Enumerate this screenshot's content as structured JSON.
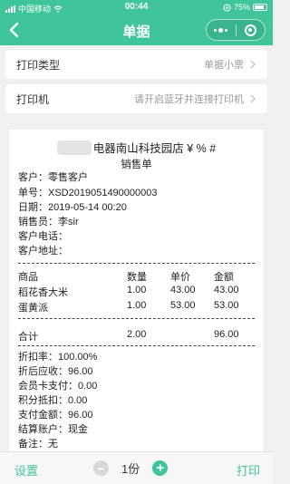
{
  "status_bar": {
    "carrier": "中国移动",
    "time": "00:44",
    "battery": "75%"
  },
  "nav": {
    "title": "单据"
  },
  "settings": {
    "print_type_label": "打印类型",
    "print_type_value": "单据小票",
    "printer_label": "打印机",
    "printer_value": "请开启蓝牙并连接打印机"
  },
  "receipt": {
    "store_name": "电器南山科技园店 ¥ % #",
    "doc_type": "销售单",
    "customer": "客户：零售客户",
    "order_no": "单号：XSD2019051490000003",
    "date": "日期：2019-05-14 00:20",
    "salesperson": "销售员：李sir",
    "phone": "客户电话：",
    "address": "客户地址：",
    "divider": "----------------------------------------------------------",
    "columns": [
      "商品",
      "数量",
      "单价",
      "金额"
    ],
    "items": [
      {
        "name": "稻花香大米",
        "qty": "1.00",
        "price": "43.00",
        "amount": "43.00"
      },
      {
        "name": "蛋黄派",
        "qty": "1.00",
        "price": "53.00",
        "amount": "53.00"
      }
    ],
    "total": {
      "label": "合计",
      "qty": "2.00",
      "amount": "96.00"
    },
    "discount_rate": "折扣率：100.00%",
    "after_discount": "折后应收：96.00",
    "member_card": "会员卡支付：0.00",
    "points": "积分抵扣：0.00",
    "paid": "支付金额：96.00",
    "account": "结算账户：现金",
    "remark": "备注：无"
  },
  "bottom_bar": {
    "settings_label": "设置",
    "copies": "1份",
    "minus": "−",
    "plus": "+",
    "print_label": "打印"
  },
  "colors": {
    "accent": "#3fc49b"
  }
}
